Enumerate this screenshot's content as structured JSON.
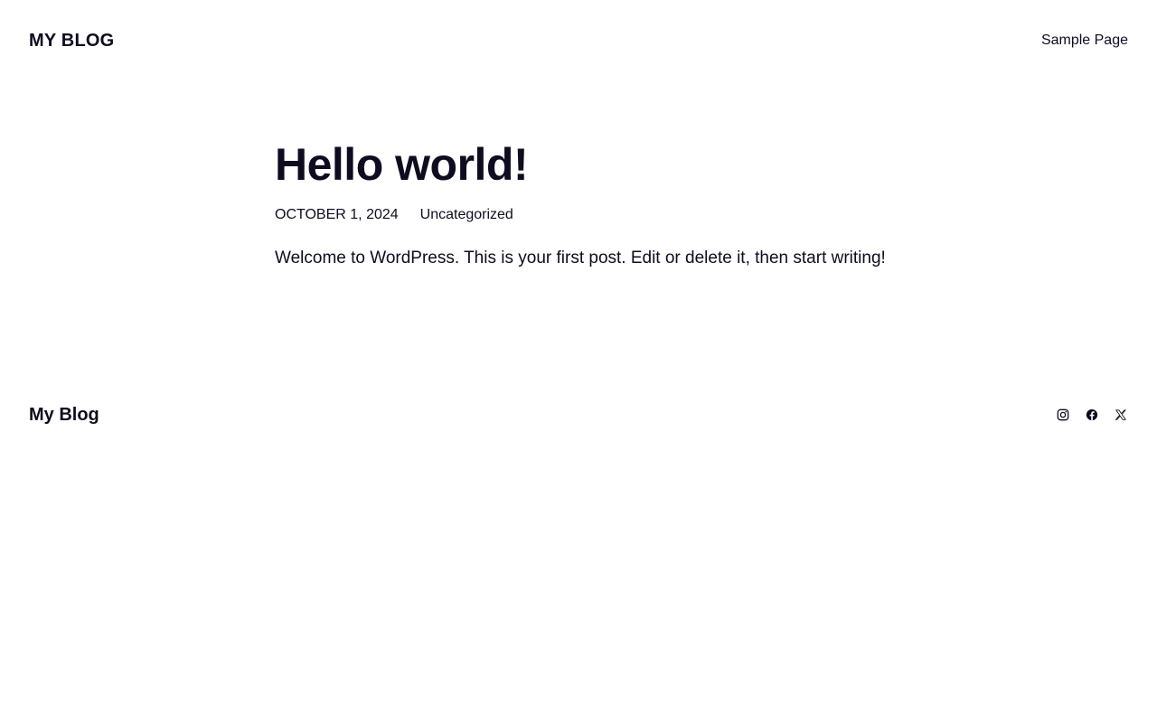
{
  "header": {
    "site_title": "MY BLOG",
    "nav": [
      {
        "label": "Sample Page"
      }
    ]
  },
  "post": {
    "title": "Hello world!",
    "date": "OCTOBER 1, 2024",
    "category": "Uncategorized",
    "content": "Welcome to WordPress. This is your first post. Edit or delete it, then start writing!"
  },
  "footer": {
    "site_title": "My Blog",
    "social_icons": [
      "instagram-icon",
      "facebook-icon",
      "x-icon"
    ]
  },
  "colors": {
    "text": "#0f0c1f",
    "background": "#ffffff"
  }
}
